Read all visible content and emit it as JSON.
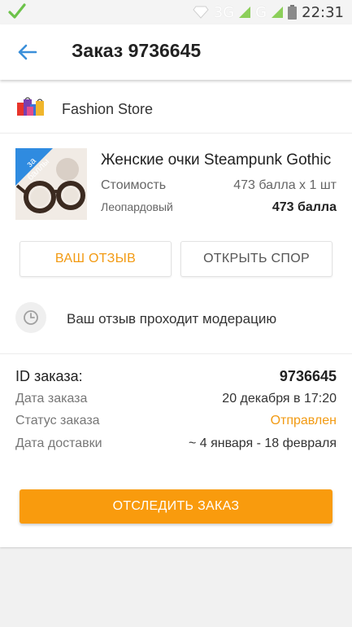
{
  "status_bar": {
    "network_1": "3G",
    "network_2": "G",
    "time": "22:31"
  },
  "header": {
    "title": "Заказ 9736645"
  },
  "store": {
    "name": "Fashion Store"
  },
  "product": {
    "badge": [
      "за",
      "баллы"
    ],
    "name": "Женские очки Steampunk Gothic",
    "price_label": "Стоимость",
    "price_value": "473 балла x 1 шт",
    "variant": "Леопардовый",
    "total": "473 балла"
  },
  "actions": {
    "review_label": "ВАШ ОТЗЫВ",
    "dispute_label": "ОТКРЫТЬ СПОР"
  },
  "moderation": {
    "text": "Ваш отзыв проходит модерацию"
  },
  "order_info": {
    "id_label": "ID заказа:",
    "id_value": "9736645",
    "date_label": "Дата заказа",
    "date_value": "20 декабря в 17:20",
    "status_label": "Статус заказа",
    "status_value": "Отправлен",
    "delivery_label": "Дата доставки",
    "delivery_value": "~ 4 января - 18 февраля"
  },
  "track_button": {
    "label": "ОТСЛЕДИТЬ ЗАКАЗ"
  },
  "colors": {
    "accent": "#f99b0d",
    "status_sent": "#f29a12",
    "back_arrow": "#3a8fd9",
    "badge_blue": "#2f8be0"
  }
}
